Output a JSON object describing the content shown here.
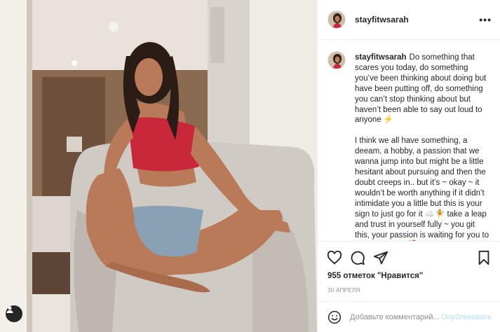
{
  "post": {
    "username": "stayfitwsarah",
    "more_label": "•••",
    "caption_paragraph_1": "Do something that scares you today, do something you’ve been thinking about doing but have been putting off, do something you can’t stop thinking about but haven’t been able to say out loud to anyone ⚡",
    "caption_paragraph_2": "I think we all have something, a deeam, a hobby, a passion that we wanna jump into but might be a little hesitant about pursuing and then the doubt creeps in.. but it’s ~ okay ~ it wouldn’t be worth anything if it didn’t intimidate you a little but this is your sign to just go for it ☁️🧚 take a leap and trust in yourself fully ~ you git this, your passion is waiting for you to take it and run🥰",
    "likes": "955 отметок \"Нравится\"",
    "date": "30 АПРЕЛЯ"
  },
  "comment_box": {
    "placeholder": "Добавьте комментарий...",
    "publish_label": "Опубликовать"
  },
  "icons": {
    "like": "heart-icon",
    "comment": "comment-bubble-icon",
    "share": "paper-plane-icon",
    "save": "bookmark-icon",
    "emoji": "emoji-icon",
    "user_tag": "user-icon"
  },
  "colors": {
    "text": "#262626",
    "muted": "#8e8e8e",
    "publish_disabled": "#b2dffc",
    "border": "#efefef"
  }
}
